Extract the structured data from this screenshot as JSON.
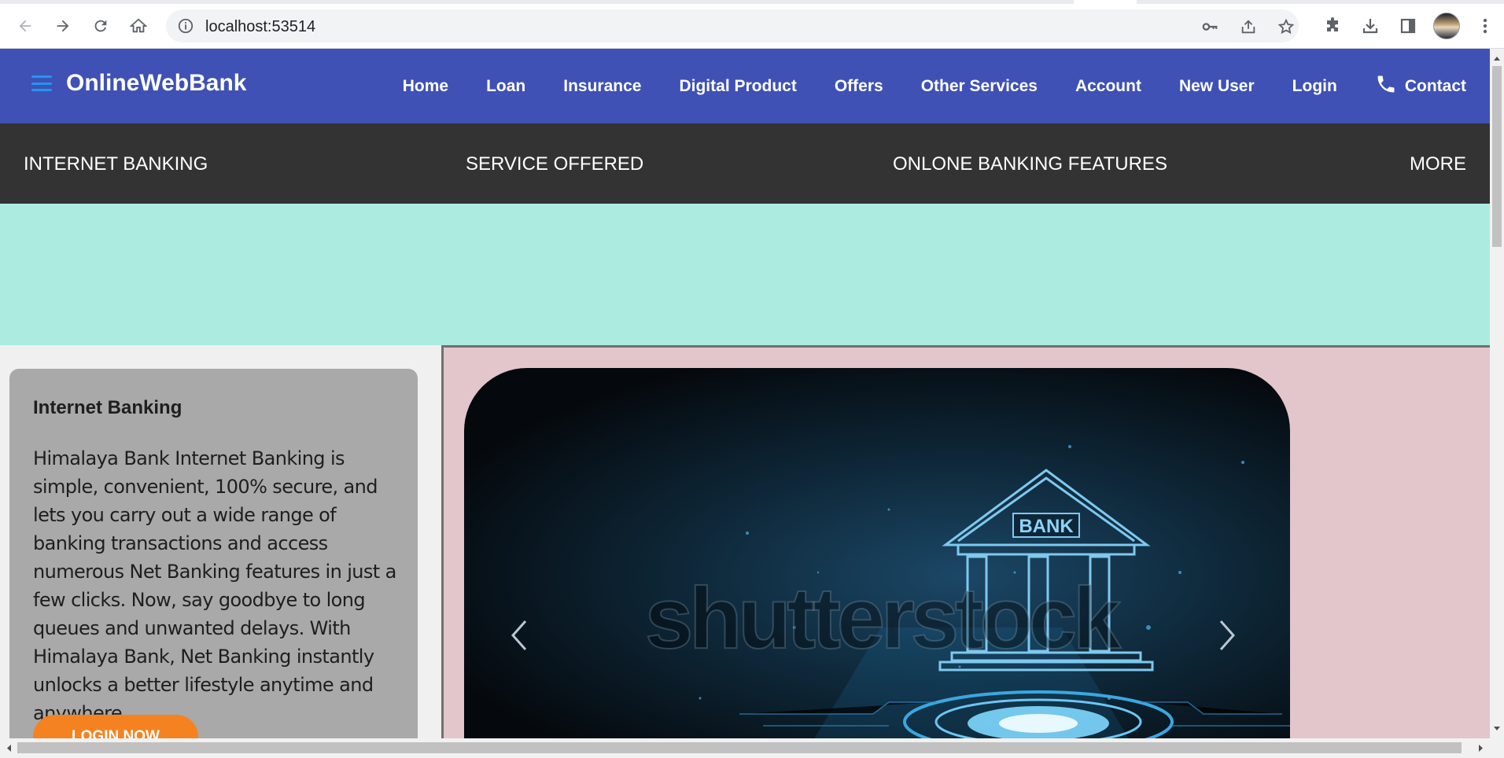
{
  "browser": {
    "url": "localhost:53514",
    "icons": [
      "back-icon",
      "forward-icon",
      "reload-icon",
      "home-icon",
      "info-icon",
      "key-icon",
      "share-icon",
      "star-icon",
      "extensions-icon",
      "download-icon",
      "sidepanel-icon",
      "menu-icon"
    ]
  },
  "header": {
    "brand": "OnlineWebBank",
    "nav": [
      {
        "label": "Home"
      },
      {
        "label": "Loan"
      },
      {
        "label": "Insurance"
      },
      {
        "label": "Digital Product"
      },
      {
        "label": "Offers"
      },
      {
        "label": "Other Services"
      },
      {
        "label": "Account"
      },
      {
        "label": "New User"
      },
      {
        "label": "Login"
      },
      {
        "label": "Contact"
      }
    ]
  },
  "subnav": {
    "items": [
      {
        "label": "INTERNET BANKING"
      },
      {
        "label": "SERVICE OFFERED"
      },
      {
        "label": "ONLONE BANKING FEATURES"
      },
      {
        "label": "MORE"
      }
    ]
  },
  "card": {
    "title": "Internet Banking",
    "body": "Himalaya Bank Internet Banking is simple, convenient, 100% secure, and lets you carry out a wide range of banking transactions and access numerous Net Banking features in just a few clicks. Now, say goodbye to long queues and unwanted delays. With Himalaya Bank, Net Banking instantly unlocks a better lifestyle anytime and anywhere",
    "button": "LOGIN NOW"
  },
  "carousel": {
    "sign_text": "BANK",
    "watermark": "shutterstock"
  },
  "colors": {
    "nav_bg": "#3f51b5",
    "subnav_bg": "#333333",
    "teal": "#acebe0",
    "card_bg": "#a9a9a9",
    "pink": "#e2c6cb",
    "button": "#f58220"
  }
}
